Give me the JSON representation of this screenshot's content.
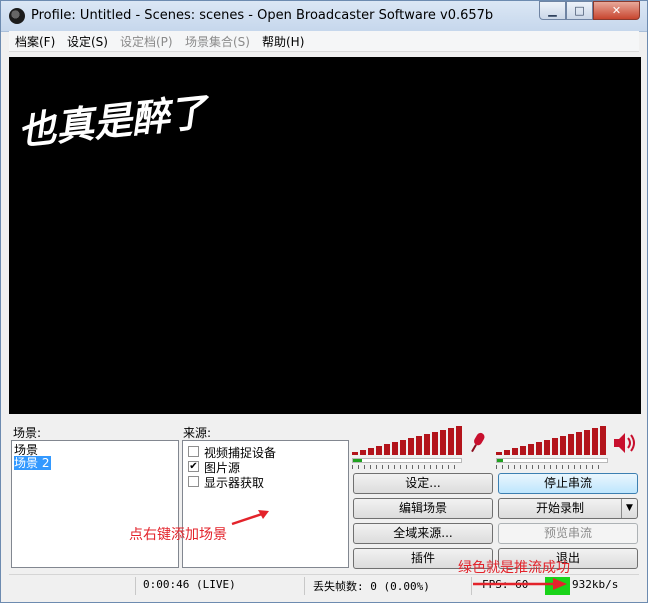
{
  "window": {
    "title": "Profile: Untitled - Scenes: scenes - Open Broadcaster Software v0.657b",
    "controls": {
      "minimize": "▁",
      "maximize": "□",
      "close": "✕"
    }
  },
  "menu": [
    {
      "label": "档案(F)",
      "enabled": true
    },
    {
      "label": "设定(S)",
      "enabled": true
    },
    {
      "label": "设定档(P)",
      "enabled": false
    },
    {
      "label": "场景集合(S)",
      "enabled": false
    },
    {
      "label": "帮助(H)",
      "enabled": true
    }
  ],
  "preview": {
    "overlay_text": "也真是醉了"
  },
  "scenes": {
    "label": "场景:",
    "items": [
      {
        "label": "场景",
        "selected": false
      },
      {
        "label": "场景 2",
        "selected": true
      }
    ]
  },
  "sources": {
    "label": "来源:",
    "items": [
      {
        "label": "视频捕捉设备",
        "checked": false
      },
      {
        "label": "图片源",
        "checked": true
      },
      {
        "label": "显示器获取",
        "checked": false
      }
    ]
  },
  "meters": {
    "mic": {
      "icon": "microphone-icon",
      "level": 0.08
    },
    "desktop": {
      "icon": "speaker-icon",
      "level": 0.05
    }
  },
  "buttons": {
    "settings": "设定...",
    "stop_stream": "停止串流",
    "edit_scene": "编辑场景",
    "start_recording": "开始录制",
    "global_sources": "全域来源...",
    "preview_stream": "预览串流",
    "plugins": "插件",
    "exit": "退出"
  },
  "status": {
    "time": "0:00:46 (LIVE)",
    "dropped_frames": "丢失帧数: 0 (0.00%)",
    "fps": "FPS: 60",
    "bitrate": "932kb/s",
    "live_color": "#19d319"
  },
  "annotations": {
    "right_click_hint": "点右键添加场景",
    "green_hint": "绿色就是推流成功"
  },
  "colors": {
    "meter_red": "#b3141b",
    "meter_green": "#1fa11f",
    "annotation_red": "#e3232b",
    "selection_blue": "#3399ff"
  }
}
